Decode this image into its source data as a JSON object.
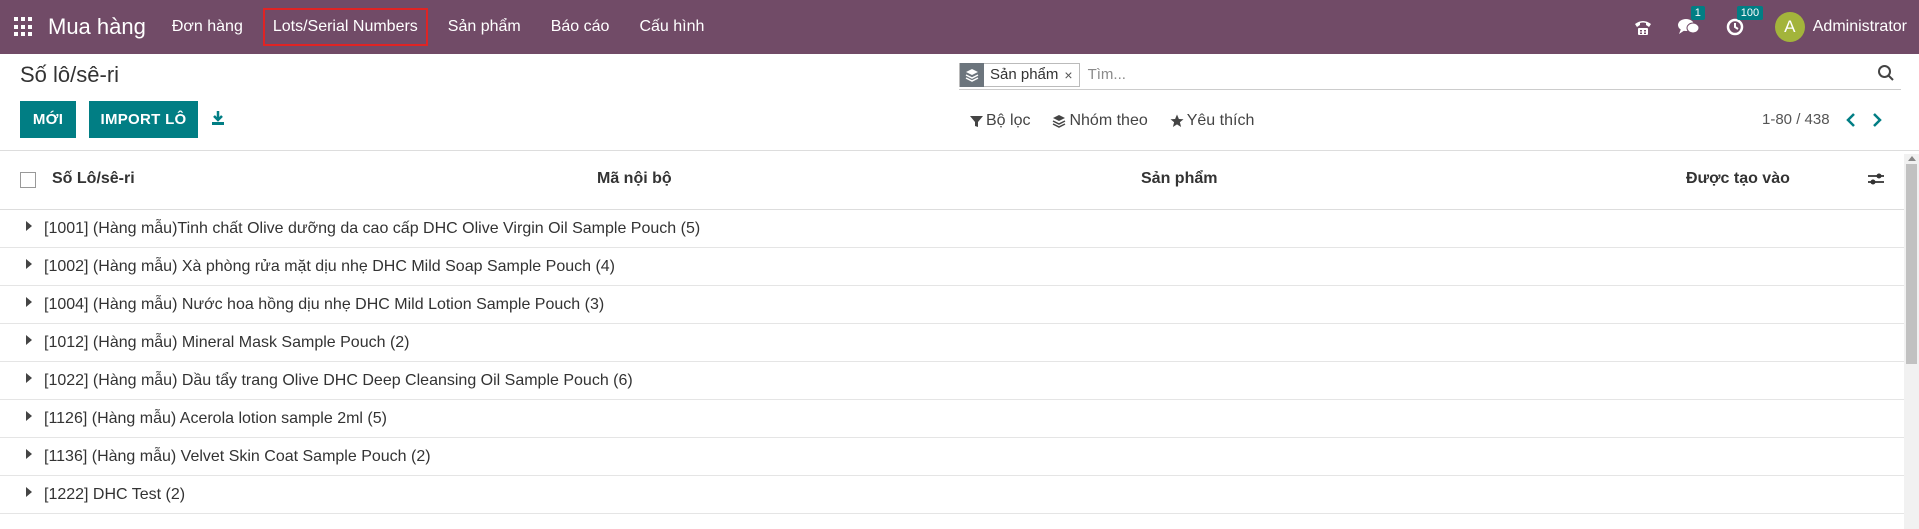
{
  "navbar": {
    "brand": "Mua hàng",
    "menu": [
      {
        "label": "Đơn hàng"
      },
      {
        "label": "Lots/Serial Numbers"
      },
      {
        "label": "Sản phẩm"
      },
      {
        "label": "Báo cáo"
      },
      {
        "label": "Cấu hình"
      }
    ],
    "messages_badge": "1",
    "activities_badge": "100",
    "avatar_letter": "A",
    "user_name": "Administrator",
    "color": "#714b67"
  },
  "page": {
    "title": "Số lô/sê-ri",
    "new_button": "MỚI",
    "import_button": "IMPORT LÔ"
  },
  "search": {
    "facet_label": "Sản phẩm",
    "facet_close": "×",
    "placeholder": "Tìm..."
  },
  "filters": {
    "filter_label": "Bộ lọc",
    "group_label": "Nhóm theo",
    "favorite_label": "Yêu thích"
  },
  "pager": {
    "value": "1-80 / 438"
  },
  "table": {
    "columns": [
      "Số Lô/sê-ri",
      "Mã nội bộ",
      "Sản phẩm",
      "Được tạo vào"
    ],
    "groups": [
      "[1001] (Hàng mẫu)Tinh chất Olive dưỡng da cao cấp DHC Olive Virgin Oil Sample Pouch (5)",
      "[1002] (Hàng mẫu) Xà phòng rửa mặt dịu nhẹ DHC Mild Soap Sample Pouch (4)",
      "[1004] (Hàng mẫu) Nước hoa hồng dịu nhẹ DHC Mild Lotion Sample Pouch (3)",
      "[1012] (Hàng mẫu) Mineral Mask Sample Pouch (2)",
      "[1022] (Hàng mẫu) Dầu tẩy trang Olive DHC Deep Cleansing Oil Sample Pouch (6)",
      "[1126] (Hàng mẫu) Acerola lotion sample 2ml (5)",
      "[1136] (Hàng mẫu) Velvet Skin Coat Sample Pouch (2)",
      "[1222] DHC Test (2)"
    ]
  },
  "colors": {
    "primary": "#017e84",
    "highlight_border": "#e02424"
  }
}
